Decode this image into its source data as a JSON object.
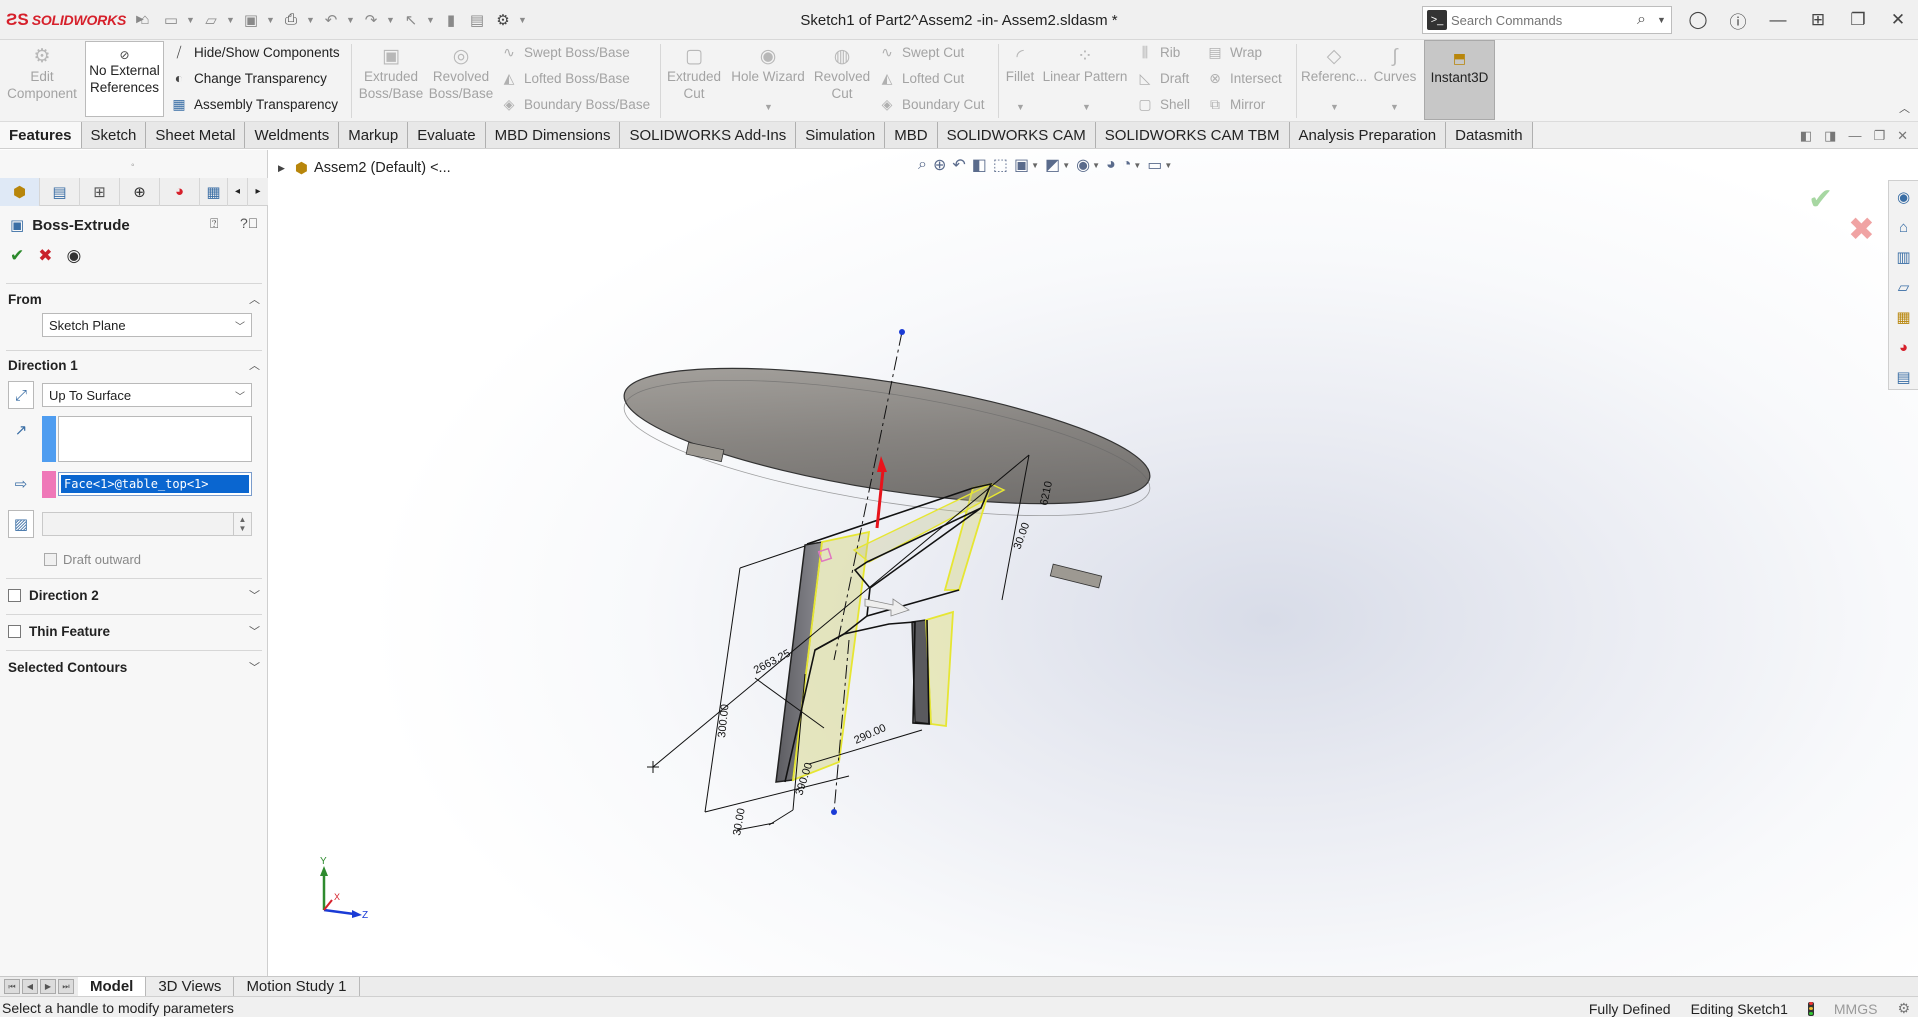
{
  "app": {
    "brand": "SOLIDWORKS",
    "window_title": "Sketch1 of Part2^Assem2 -in- Assem2.sldasm *"
  },
  "search": {
    "placeholder": "Search Commands"
  },
  "ribbon": {
    "edit_component": [
      "Edit",
      "Component"
    ],
    "no_external": [
      "No External",
      "References"
    ],
    "hide_show": "Hide/Show Components",
    "change_transparency": "Change Transparency",
    "assembly_transparency": "Assembly Transparency",
    "extruded_boss": [
      "Extruded",
      "Boss/Base"
    ],
    "revolved_boss": [
      "Revolved",
      "Boss/Base"
    ],
    "swept_boss": "Swept Boss/Base",
    "lofted_boss": "Lofted Boss/Base",
    "boundary_boss": "Boundary Boss/Base",
    "extruded_cut": [
      "Extruded",
      "Cut"
    ],
    "hole_wizard": "Hole Wizard",
    "revolved_cut": [
      "Revolved",
      "Cut"
    ],
    "swept_cut": "Swept Cut",
    "lofted_cut": "Lofted Cut",
    "boundary_cut": "Boundary Cut",
    "fillet": "Fillet",
    "linear_pattern": "Linear Pattern",
    "rib": "Rib",
    "draft": "Draft",
    "shell": "Shell",
    "wrap": "Wrap",
    "intersect": "Intersect",
    "mirror": "Mirror",
    "reference": "Referenc...",
    "curves": "Curves",
    "instant3d": "Instant3D"
  },
  "tabs": [
    "Features",
    "Sketch",
    "Sheet Metal",
    "Weldments",
    "Markup",
    "Evaluate",
    "MBD Dimensions",
    "SOLIDWORKS Add-Ins",
    "Simulation",
    "MBD",
    "SOLIDWORKS CAM",
    "SOLIDWORKS CAM TBM",
    "Analysis Preparation",
    "Datasmith"
  ],
  "property_manager": {
    "title": "Boss-Extrude",
    "from_label": "From",
    "from_value": "Sketch Plane",
    "direction1_label": "Direction 1",
    "end_condition": "Up To Surface",
    "face_selection": "Face<1>@table_top<1>",
    "draft_outward": "Draft outward",
    "direction2_label": "Direction 2",
    "thin_feature_label": "Thin Feature",
    "selected_contours_label": "Selected Contours"
  },
  "tree": {
    "root": "Assem2 (Default) <..."
  },
  "dimensions": {
    "d1": "2663.25",
    "d2": "290.00",
    "d3": "300.00",
    "d4": "30.00",
    "d5": "30.00",
    "d6": "390.00",
    "d7": "6210"
  },
  "triad": {
    "x": "X",
    "y": "Y",
    "z": "Z"
  },
  "bottom_tabs": [
    "Model",
    "3D Views",
    "Motion Study 1"
  ],
  "status": {
    "message": "Select a handle to modify parameters",
    "definition": "Fully Defined",
    "mode": "Editing Sketch1",
    "units": "MMGS"
  },
  "colors": {
    "brand_red": "#d6202b",
    "selection_blue": "#0a66d0",
    "sketch_yellow": "#e8e84a",
    "ok_green": "#2c8a2c",
    "cancel_red": "#c9212b"
  }
}
